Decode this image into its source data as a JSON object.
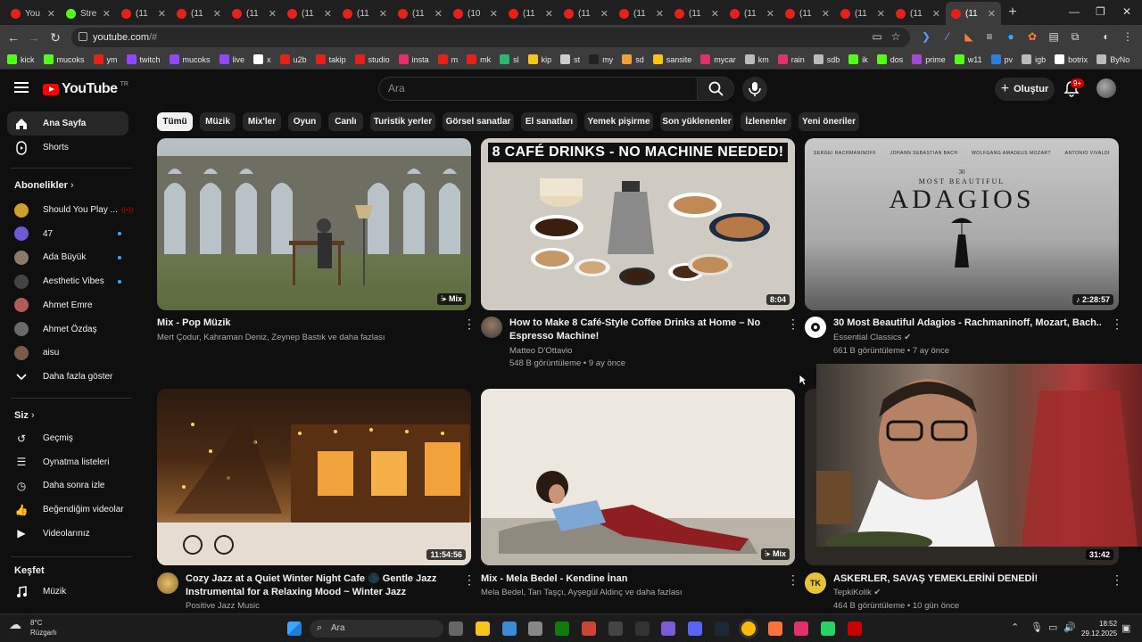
{
  "browser": {
    "tabs": [
      {
        "label": "You",
        "icon": "youtube-icon",
        "color": "#e62117"
      },
      {
        "label": "Stre",
        "icon": "kick-icon",
        "color": "#53fc18"
      },
      {
        "label": "(11",
        "icon": "youtube-icon",
        "color": "#e62117"
      },
      {
        "label": "(11",
        "icon": "youtube-icon",
        "color": "#e62117"
      },
      {
        "label": "(11",
        "icon": "youtube-icon",
        "color": "#e62117"
      },
      {
        "label": "(11",
        "icon": "youtube-icon",
        "color": "#e62117"
      },
      {
        "label": "(11",
        "icon": "youtube-icon",
        "color": "#e62117"
      },
      {
        "label": "(11",
        "icon": "youtube-icon",
        "color": "#e62117"
      },
      {
        "label": "(10",
        "icon": "youtube-icon",
        "color": "#e62117"
      },
      {
        "label": "(11",
        "icon": "youtube-icon",
        "color": "#e62117"
      },
      {
        "label": "(11",
        "icon": "youtube-icon",
        "color": "#e62117"
      },
      {
        "label": "(11",
        "icon": "youtube-icon",
        "color": "#e62117"
      },
      {
        "label": "(11",
        "icon": "youtube-icon",
        "color": "#e62117"
      },
      {
        "label": "(11",
        "icon": "youtube-icon",
        "color": "#e62117"
      },
      {
        "label": "(11",
        "icon": "youtube-icon",
        "color": "#e62117"
      },
      {
        "label": "(11",
        "icon": "youtube-icon",
        "color": "#e62117"
      },
      {
        "label": "(11",
        "icon": "youtube-icon",
        "color": "#e62117"
      },
      {
        "label": "(11",
        "icon": "youtube-icon",
        "color": "#e62117",
        "active": true
      }
    ],
    "new_tab": "+",
    "url_host": "youtube.com",
    "url_path": "/#",
    "bookmarks": [
      {
        "label": "kick",
        "color": "#53fc18"
      },
      {
        "label": "mucoks",
        "color": "#53fc18"
      },
      {
        "label": "ym",
        "color": "#e62117"
      },
      {
        "label": "twitch",
        "color": "#9146ff"
      },
      {
        "label": "mucoks",
        "color": "#9146ff"
      },
      {
        "label": "live",
        "color": "#9146ff"
      },
      {
        "label": "x",
        "color": "#ffffff"
      },
      {
        "label": "u2b",
        "color": "#e62117"
      },
      {
        "label": "takip",
        "color": "#e62117"
      },
      {
        "label": "studio",
        "color": "#e62117"
      },
      {
        "label": "insta",
        "color": "#e1306c"
      },
      {
        "label": "m",
        "color": "#e62117"
      },
      {
        "label": "mk",
        "color": "#e62117"
      },
      {
        "label": "sl",
        "color": "#2bb673"
      },
      {
        "label": "kip",
        "color": "#f5c518"
      },
      {
        "label": "st",
        "color": "#cccccc"
      },
      {
        "label": "my",
        "color": "#222222"
      },
      {
        "label": "sd",
        "color": "#f2a03d"
      },
      {
        "label": "sansite",
        "color": "#f5c518"
      },
      {
        "label": "mycar",
        "color": "#e1306c"
      },
      {
        "label": "km",
        "color": "#bbbbbb"
      },
      {
        "label": "rain",
        "color": "#e1306c"
      },
      {
        "label": "sdb",
        "color": "#bbbbbb"
      },
      {
        "label": "ik",
        "color": "#53fc18"
      },
      {
        "label": "dos",
        "color": "#53fc18"
      },
      {
        "label": "prime",
        "color": "#a349d6"
      },
      {
        "label": "w11",
        "color": "#53fc18"
      },
      {
        "label": "pv",
        "color": "#2e7dd7"
      },
      {
        "label": "igb",
        "color": "#bbbbbb"
      },
      {
        "label": "botrix",
        "color": "#ffffff"
      },
      {
        "label": "ByNo",
        "color": "#bbbbbb"
      }
    ]
  },
  "header": {
    "logo_text": "YouTube",
    "logo_region": "TR",
    "search_placeholder": "Ara",
    "create_label": "Oluştur",
    "notification_badge": "9+"
  },
  "sidebar": {
    "home": "Ana Sayfa",
    "shorts": "Shorts",
    "subscriptions_title": "Abonelikler",
    "subscriptions": [
      {
        "label": "Should You Play ...",
        "live": true,
        "color": "#c9a227"
      },
      {
        "label": "47",
        "dot": true,
        "color": "#6d5ad6"
      },
      {
        "label": "Ada Büyük",
        "dot": true,
        "color": "#8a7a6a"
      },
      {
        "label": "Aesthetic Vibes",
        "dot": true,
        "color": "#444444"
      },
      {
        "label": "Ahmet Emre",
        "dot": false,
        "color": "#b05a5a"
      },
      {
        "label": "Ahmet Özdaş",
        "dot": false,
        "color": "#6a6a6a"
      },
      {
        "label": "aisu",
        "dot": false,
        "color": "#7a5a4a"
      }
    ],
    "show_more": "Daha fazla göster",
    "you_title": "Siz",
    "you_items": [
      "Geçmiş",
      "Oynatma listeleri",
      "Daha sonra izle",
      "Beğendiğim videolar",
      "Videolarınız"
    ],
    "explore_title": "Keşfet",
    "explore_items": [
      "Müzik"
    ]
  },
  "chips": [
    "Tümü",
    "Müzik",
    "Mix'ler",
    "Oyun",
    "Canlı",
    "Turistik yerler",
    "Görsel sanatlar",
    "El sanatları",
    "Yemek pişirme",
    "Son yüklenenler",
    "İzlenenler",
    "Yeni öneriler"
  ],
  "videos": [
    {
      "title": "Mix - Pop Müzik",
      "line1": "Mert Çodur, Kahraman Deniz, Zeynep Bastık ve daha fazlası",
      "line2": "",
      "badge": "Mix"
    },
    {
      "title": "How to Make 8 Café-Style Coffee Drinks at Home – No Espresso Machine!",
      "line1": "Matteo D'Ottavio",
      "line2": "548 B görüntüleme • 9 ay önce",
      "badge": "8:04",
      "thumb_text": "8 CAFÉ DRINKS - NO MACHINE NEEDED!"
    },
    {
      "title": "30 Most Beautiful Adagios - Rachmaninoff, Mozart, Bach...",
      "line1": "Essential Classics",
      "line2": "661 B görüntüleme • 7 ay önce",
      "badge": "2:28:57",
      "thumb_small": "30",
      "thumb_sub": "MOST BEAUTIFUL",
      "thumb_big": "ADAGIOS",
      "thumb_composers": [
        "SERGEI RACHMANINOFF",
        "JOHANN SEBASTIAN BACH",
        "WOLFGANG AMADEUS MOZART",
        "ANTONIO VIVALDI"
      ]
    },
    {
      "title": "Cozy Jazz at a Quiet Winter Night Cafe 🌑 Gentle Jazz Instrumental for a Relaxing Mood ~ Winter Jazz",
      "line1": "Positive Jazz Music",
      "line2": "",
      "badge": "11:54:56"
    },
    {
      "title": "Mix - Mela Bedel - Kendine İnan",
      "line1": "Mela Bedel, Tan Taşçı, Ayşegül Aldinç ve daha fazlası",
      "line2": "",
      "badge": "Mix"
    },
    {
      "title": "ASKERLER, SAVAŞ YEMEKLERİNİ DENEDİ!",
      "line1": "TepkiKolik",
      "line2": "464 B görüntüleme • 10 gün önce",
      "badge": "31:42",
      "avatar_text": "TK"
    }
  ],
  "taskbar": {
    "temperature": "8°C",
    "weather": "Rüzgarlı",
    "search": "Ara",
    "time": "18:52",
    "date": "29.12.2025"
  }
}
